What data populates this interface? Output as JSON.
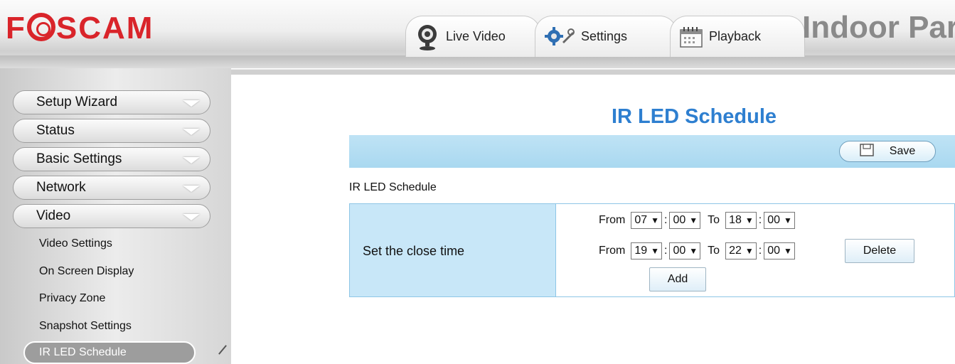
{
  "header": {
    "logo": "FOSCAM",
    "model_title": "Indoor Par",
    "tabs": [
      {
        "label": "Live Video",
        "icon": "webcam-icon"
      },
      {
        "label": "Settings",
        "icon": "gears-icon"
      },
      {
        "label": "Playback",
        "icon": "calendar-icon"
      }
    ]
  },
  "sidebar": {
    "main_items": [
      "Setup Wizard",
      "Status",
      "Basic Settings",
      "Network",
      "Video"
    ],
    "sub_items": [
      "Video Settings",
      "On Screen Display",
      "Privacy Zone",
      "Snapshot Settings"
    ],
    "active_item": "IR LED Schedule"
  },
  "main": {
    "page_title": "IR LED Schedule",
    "save_label": "Save",
    "section_label": "IR LED Schedule",
    "set_close_time_label": "Set the close time",
    "from_label": "From",
    "to_label": "To",
    "schedules": [
      {
        "from_hour": "07",
        "from_min": "00",
        "to_hour": "18",
        "to_min": "00"
      },
      {
        "from_hour": "19",
        "from_min": "00",
        "to_hour": "22",
        "to_min": "00"
      }
    ],
    "delete_label": "Delete",
    "add_label": "Add"
  },
  "colors": {
    "brand_red": "#d9242a",
    "title_blue": "#2e7fd0",
    "light_blue_bar": "#bfe3f5",
    "table_left_bg": "#c8e7f8"
  }
}
